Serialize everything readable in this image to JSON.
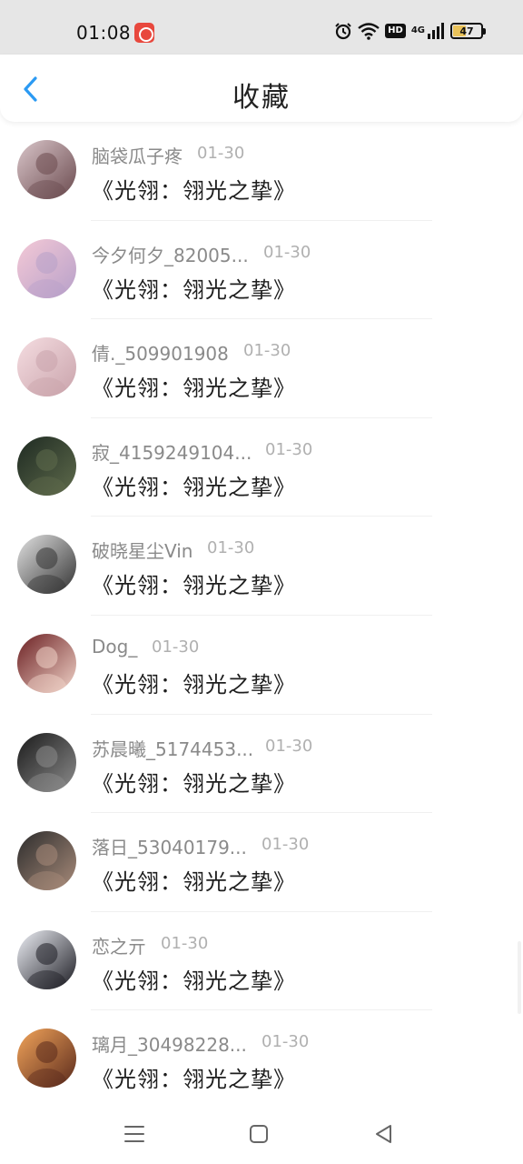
{
  "status_bar": {
    "time": "01:08",
    "battery": "47",
    "network": "4G",
    "hd": "HD"
  },
  "header": {
    "title": "收藏",
    "back_icon": "chevron-left-icon",
    "accent_color": "#2b9af3"
  },
  "items": [
    {
      "name": "脑袋瓜子疼",
      "date": "01-30",
      "title": "《光翎：翎光之挚》",
      "avatar_colors": [
        "#d9c5c9",
        "#6b4b4f"
      ]
    },
    {
      "name": "今夕何夕_82005...",
      "date": "01-30",
      "title": "《光翎：翎光之挚》",
      "avatar_colors": [
        "#f4c9d6",
        "#b7a0c9"
      ]
    },
    {
      "name": "倩._509901908",
      "date": "01-30",
      "title": "《光翎：翎光之挚》",
      "avatar_colors": [
        "#f5dde1",
        "#c9a3ab"
      ]
    },
    {
      "name": "寂_4159249104...",
      "date": "01-30",
      "title": "《光翎：翎光之挚》",
      "avatar_colors": [
        "#1e2a22",
        "#5f6b4c"
      ]
    },
    {
      "name": "破晓星尘Vin",
      "date": "01-30",
      "title": "《光翎：翎光之挚》",
      "avatar_colors": [
        "#e2e2e2",
        "#333333"
      ]
    },
    {
      "name": "Dog_",
      "date": "01-30",
      "title": "《光翎：翎光之挚》",
      "avatar_colors": [
        "#6b1f22",
        "#f1d4c9"
      ]
    },
    {
      "name": "苏晨曦_5174453...",
      "date": "01-30",
      "title": "《光翎：翎光之挚》",
      "avatar_colors": [
        "#1a1a1a",
        "#8d8d8d"
      ]
    },
    {
      "name": "落日_53040179...",
      "date": "01-30",
      "title": "《光翎：翎光之挚》",
      "avatar_colors": [
        "#2c2c2c",
        "#a88b7a"
      ]
    },
    {
      "name": "恋之亓",
      "date": "01-30",
      "title": "《光翎：翎光之挚》",
      "avatar_colors": [
        "#eef0f6",
        "#1d1d24"
      ]
    },
    {
      "name": "璃月_30498228...",
      "date": "01-30",
      "title": "《光翎：翎光之挚》",
      "avatar_colors": [
        "#f2a45a",
        "#5a2a1c"
      ]
    }
  ],
  "nav_bar": {
    "menu_icon": "menu-icon",
    "home_icon": "home-square-icon",
    "back_icon": "back-triangle-icon"
  }
}
